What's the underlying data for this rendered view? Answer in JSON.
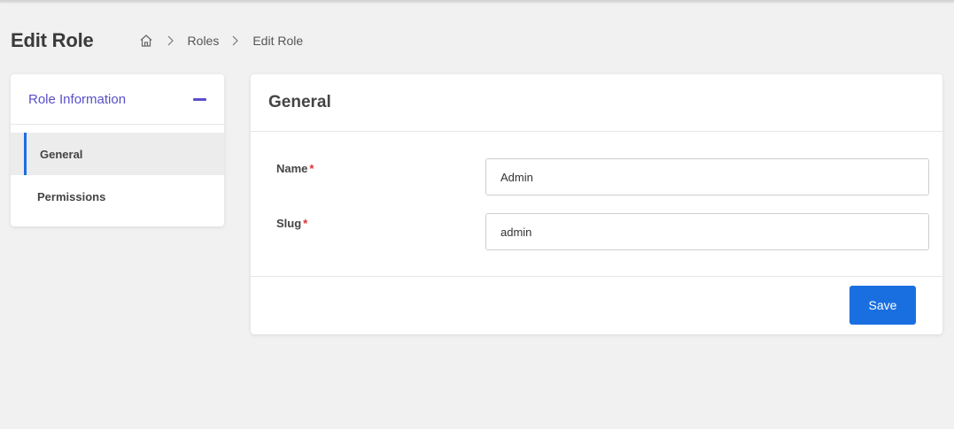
{
  "header": {
    "title": "Edit Role",
    "breadcrumb": {
      "home_icon": "home-icon",
      "items": [
        "Roles",
        "Edit Role"
      ]
    }
  },
  "sidebar": {
    "section_title": "Role Information",
    "items": [
      {
        "label": "General",
        "active": true
      },
      {
        "label": "Permissions",
        "active": false
      }
    ]
  },
  "main": {
    "title": "General",
    "fields": {
      "name": {
        "label": "Name",
        "required_mark": "*",
        "value": "Admin"
      },
      "slug": {
        "label": "Slug",
        "required_mark": "*",
        "value": "admin"
      }
    },
    "save_label": "Save"
  },
  "colors": {
    "accent": "#5a4fc8",
    "primary": "#1a6fe0",
    "required": "#e03131",
    "background": "#f1f1f1"
  }
}
